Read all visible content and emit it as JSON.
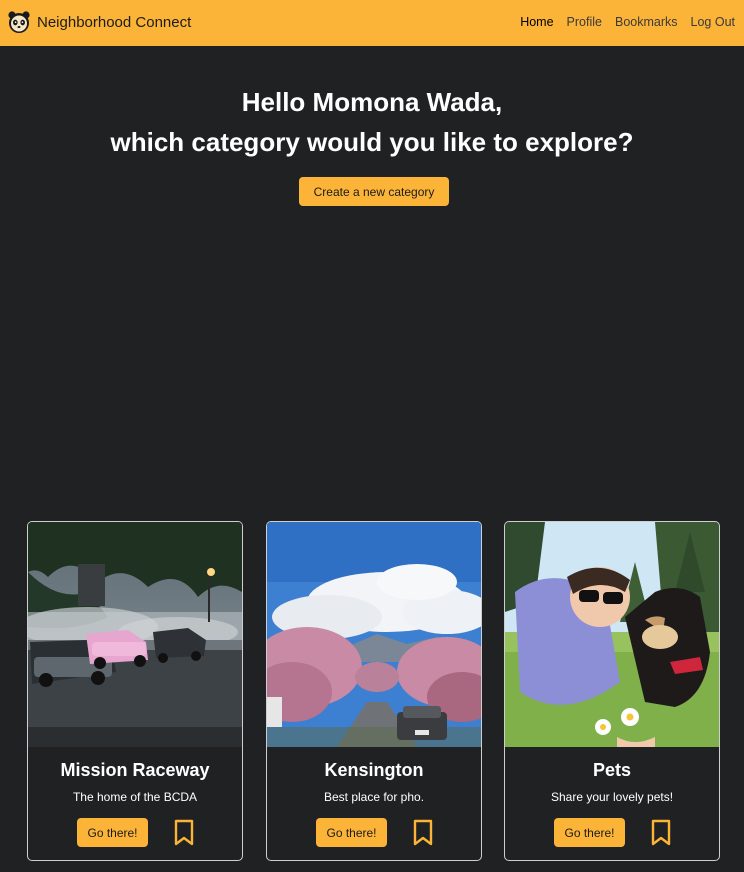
{
  "nav": {
    "brand": "Neighborhood Connect",
    "brand_icon": "panda-icon",
    "links": [
      "Home",
      "Profile",
      "Bookmarks",
      "Log Out"
    ],
    "active": "Home"
  },
  "hero": {
    "line1": "Hello Momona Wada,",
    "line2": "which category would you like to explore?",
    "create_button": "Create a new category"
  },
  "cards": [
    {
      "title": "Mission Raceway",
      "description": "The home of the BCDA",
      "button": "Go there!",
      "bookmark_icon": "bookmark-icon"
    },
    {
      "title": "Kensington",
      "description": "Best place for pho.",
      "button": "Go there!",
      "bookmark_icon": "bookmark-icon"
    },
    {
      "title": "Pets",
      "description": "Share your lovely pets!",
      "button": "Go there!",
      "bookmark_icon": "bookmark-icon"
    }
  ],
  "colors": {
    "accent": "#fbb437",
    "background": "#1f2123"
  }
}
